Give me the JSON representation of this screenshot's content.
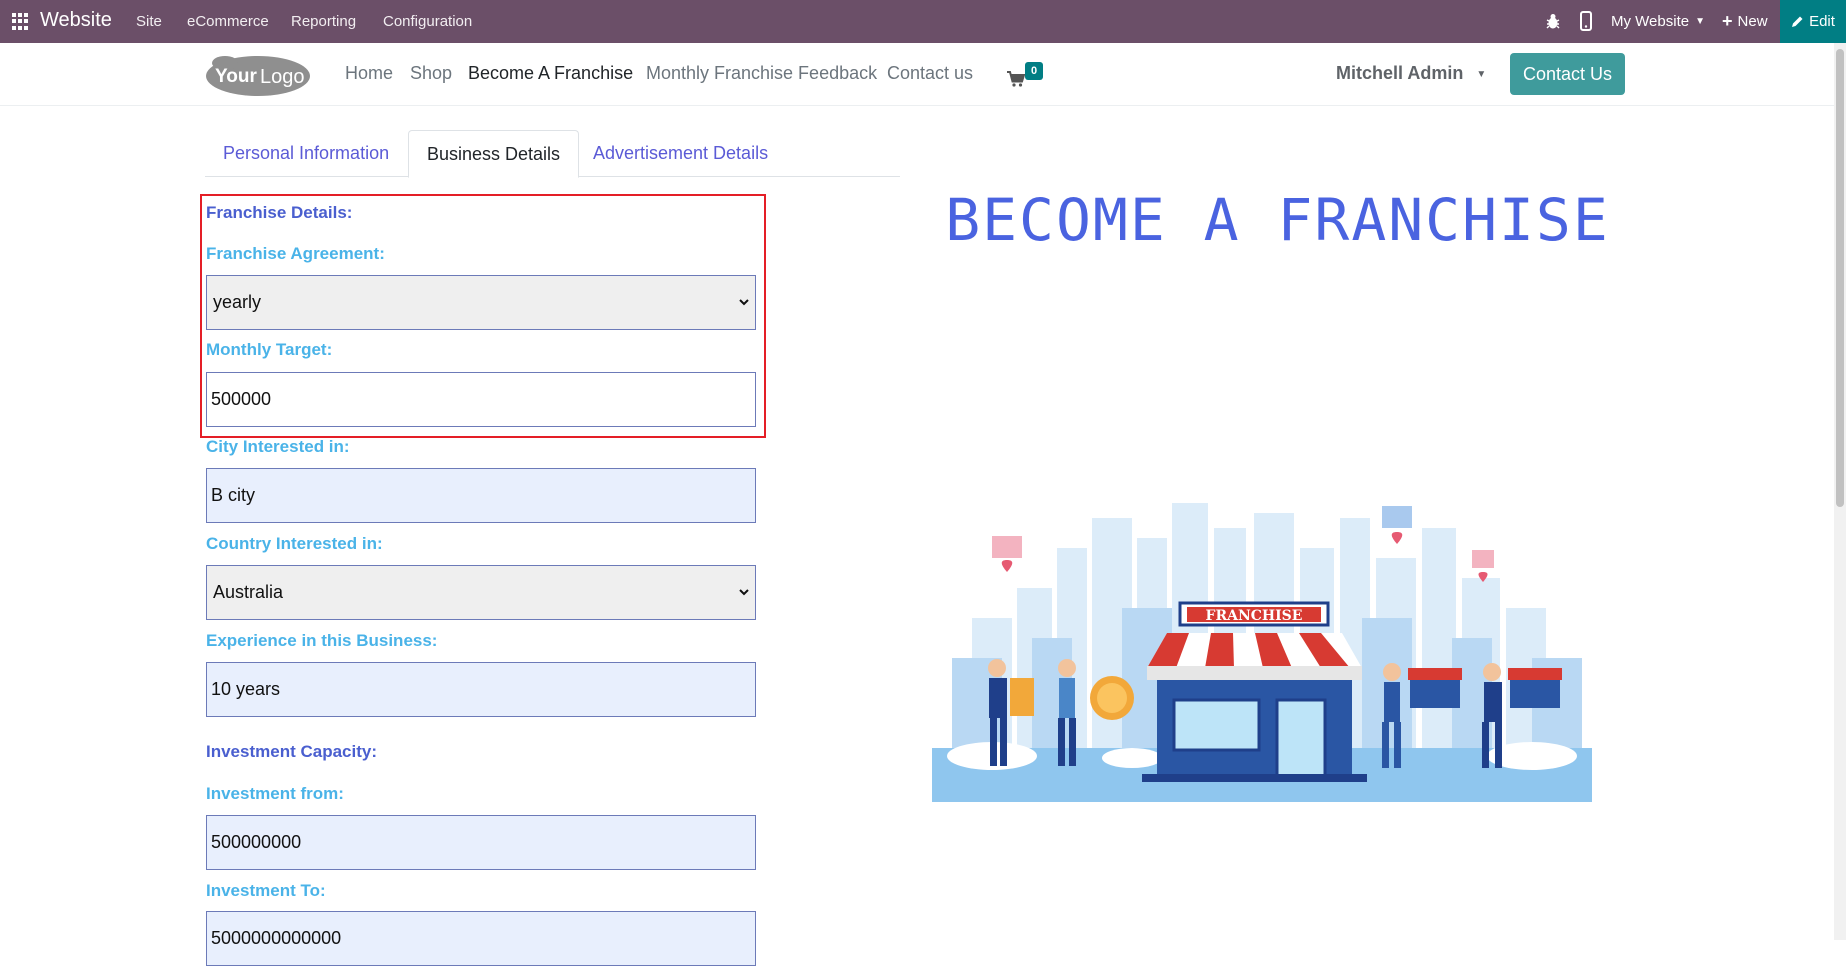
{
  "topbar": {
    "brand": "Website",
    "menu": [
      "Site",
      "eCommerce",
      "Reporting",
      "Configuration"
    ],
    "my_website": "My Website",
    "new_label": "New",
    "edit_label": "Edit"
  },
  "header": {
    "logo_text": "YourLogo",
    "nav": [
      "Home",
      "Shop",
      "Become A Franchise",
      "Monthly Franchise Feedback",
      "Contact us"
    ],
    "cart_count": "0",
    "user": "Mitchell Admin",
    "contact_button": "Contact Us"
  },
  "tabs": [
    "Personal Information",
    "Business Details",
    "Advertisement Details"
  ],
  "form": {
    "franchise_details": "Franchise Details:",
    "agreement_label": "Franchise Agreement:",
    "agreement_value": "yearly",
    "target_label": "Monthly Target:",
    "target_value": "500000",
    "city_label": "City Interested in:",
    "city_value": "B city",
    "country_label": "Country Interested in:",
    "country_value": "Australia",
    "experience_label": "Experience in this Business:",
    "experience_value": "10 years",
    "investment_capacity": "Investment Capacity:",
    "investment_from_label": "Investment from:",
    "investment_from_value": "500000000",
    "investment_to_label": "Investment To:",
    "investment_to_value": "5000000000000"
  },
  "hero": {
    "title": "BECOME A FRANCHISE",
    "store_sign": "FRANCHISE"
  },
  "colors": {
    "topbar": "#6b4f68",
    "edit": "#017e84",
    "contact_button": "#3f9b9c",
    "label_dark": "#4a5fcf",
    "label_light": "#4ab3e8",
    "highlight": "#e41e26",
    "hero_title": "#4a63e0"
  }
}
